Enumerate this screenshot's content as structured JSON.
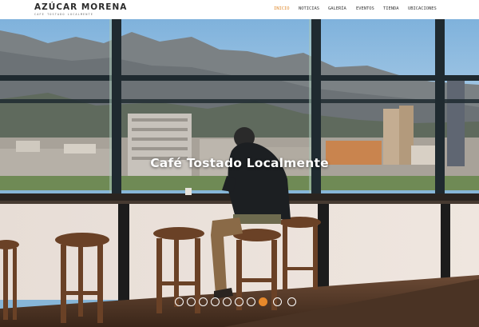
{
  "brand": {
    "title": "AZÚCAR MORENA",
    "tagline": "CAFE TOSTADO LOCALMENTE"
  },
  "nav": {
    "items": [
      {
        "label": "INICIO",
        "active": true
      },
      {
        "label": "NOTICIAS",
        "active": false
      },
      {
        "label": "GALERÍA",
        "active": false
      },
      {
        "label": "EVENTOS",
        "active": false
      },
      {
        "label": "TIENDA",
        "active": false
      },
      {
        "label": "UBICACIONES",
        "active": false
      }
    ]
  },
  "hero": {
    "caption": "Café Tostado Localmente",
    "slide_count": 10,
    "active_slide": 8
  },
  "colors": {
    "accent": "#e8892b",
    "nav_active": "#e08a2e",
    "text_dark": "#2b2b2b"
  }
}
